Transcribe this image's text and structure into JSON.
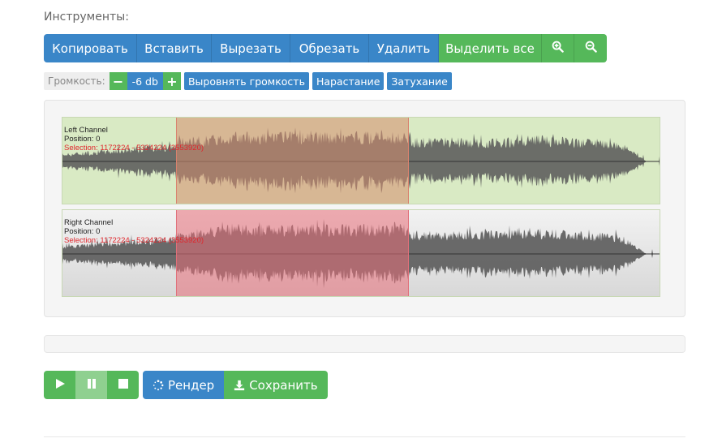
{
  "tools": {
    "title": "Инструменты:",
    "buttons": [
      {
        "label": "Копировать",
        "color": "#3a86c8"
      },
      {
        "label": "Вставить",
        "color": "#3a86c8"
      },
      {
        "label": "Вырезать",
        "color": "#3a86c8"
      },
      {
        "label": "Обрезать",
        "color": "#3a86c8"
      },
      {
        "label": "Удалить",
        "color": "#3a86c8"
      },
      {
        "label": "Выделить все",
        "color": "#55b85a"
      }
    ],
    "zoom_in_icon": "zoom-in-icon",
    "zoom_out_icon": "zoom-out-icon"
  },
  "volume": {
    "label": "Громкость:",
    "decrease_symbol": "−",
    "value": "-6 db",
    "increase_symbol": "+",
    "actions": [
      "Выровнять громкость",
      "Нарастание",
      "Затухание"
    ]
  },
  "waveform": {
    "selection_fraction": [
      0.19,
      0.58
    ],
    "channels": [
      {
        "name": "Left Channel",
        "position": "Position: 0",
        "selection": "Selection: 1172224 - 5324224 (3553920)"
      },
      {
        "name": "Right Channel",
        "position": "Position: 0",
        "selection": "Selection: 1172224 - 5324224 (3553920)"
      }
    ]
  },
  "transport": {
    "play_icon": "play-icon",
    "pause_icon": "pause-icon",
    "stop_icon": "stop-icon",
    "render_label": "Рендер",
    "save_label": "Сохранить"
  },
  "colors": {
    "primary": "#3a86c8",
    "success": "#55b85a",
    "left_channel_bg": "#d9eac4",
    "selection_left": "#d68c6e",
    "selection_right": "#e86e78",
    "selection_text": "#e0262c"
  }
}
